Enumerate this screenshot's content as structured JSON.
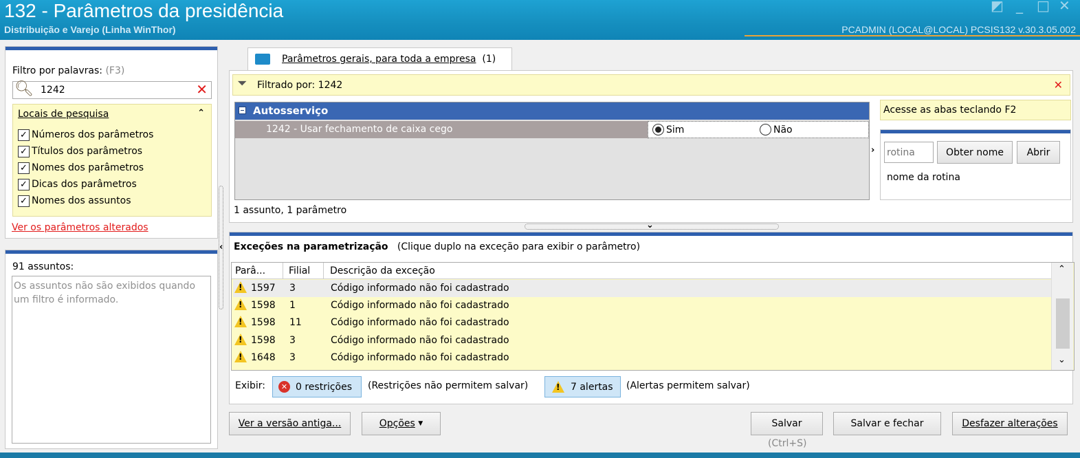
{
  "window": {
    "title": "132 - Parâmetros da presidência",
    "subtitle": "Distribuição e Varejo (Linha WinThor)",
    "user_info": "PCADMIN (LOCAL@LOCAL)   PCSIS132  v.30.3.05.002"
  },
  "filter": {
    "label": "Filtro por palavras:",
    "shortcut": "(F3)",
    "value": "1242",
    "search_locations_title": "Locais de pesquisa",
    "options": [
      {
        "label": "Números dos parâmetros",
        "checked": true
      },
      {
        "label": "Títulos dos parâmetros",
        "checked": true
      },
      {
        "label": "Nomes dos parâmetros",
        "checked": true
      },
      {
        "label": "Dicas dos parâmetros",
        "checked": true
      },
      {
        "label": "Nomes dos assuntos",
        "checked": true
      }
    ],
    "changed_link": "Ver os parâmetros alterados"
  },
  "subjects": {
    "count_label": "91 assuntos:",
    "empty_message": "Os assuntos não são exibidos quando um filtro é informado."
  },
  "tab": {
    "label": "Parâmetros gerais, para toda a empresa",
    "count": "(1)"
  },
  "filtered": {
    "label": "Filtrado por: 1242"
  },
  "params": {
    "group": "Autosserviço",
    "row_label": "1242 - Usar fechamento de caixa cego",
    "option_yes": "Sim",
    "option_no": "Não",
    "selected": "Sim",
    "summary": "1 assunto, 1 parâmetro"
  },
  "side": {
    "hint": "Acesse as abas teclando F2",
    "routine_placeholder": "rotina",
    "get_name_button": "Obter nome",
    "open_button": "Abrir",
    "routine_name": "nome da rotina"
  },
  "exceptions": {
    "title": "Exceções na parametrização",
    "hint": "(Clique duplo na exceção para exibir o parâmetro)",
    "columns": [
      "Parâ...",
      "Filial",
      "Descrição da exceção"
    ],
    "rows": [
      {
        "param": "1597",
        "filial": "3",
        "desc": "Código informado não foi cadastrado"
      },
      {
        "param": "1598",
        "filial": "1",
        "desc": "Código informado não foi cadastrado"
      },
      {
        "param": "1598",
        "filial": "11",
        "desc": "Código informado não foi cadastrado"
      },
      {
        "param": "1598",
        "filial": "3",
        "desc": "Código informado não foi cadastrado"
      },
      {
        "param": "1648",
        "filial": "3",
        "desc": "Código informado não foi cadastrado"
      }
    ],
    "show_label": "Exibir:",
    "restrictions_button": "0 restrições",
    "restrictions_note": "(Restrições não permitem salvar)",
    "alerts_button": "7 alertas",
    "alerts_note": "(Alertas permitem salvar)"
  },
  "footer": {
    "old_version": "Ver a versão antiga...",
    "options": "Opções",
    "save": "Salvar",
    "save_shortcut": "(Ctrl+S)",
    "save_close": "Salvar e fechar",
    "undo": "Desfazer alterações"
  },
  "colors": {
    "title_bar": "#1690c0",
    "accent_blue": "#2e5fae",
    "highlight_yellow": "#fdfbc8",
    "selection_row": "#a9a0a0",
    "link_red": "#e21b1b"
  }
}
